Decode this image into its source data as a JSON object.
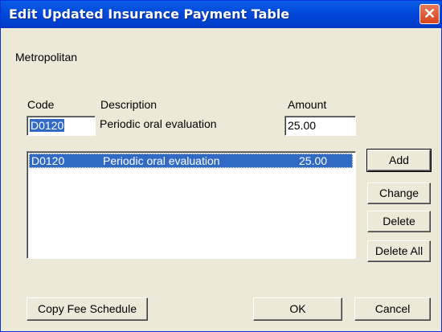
{
  "window": {
    "title": "Edit Updated Insurance Payment Table",
    "close_symbol": "✕"
  },
  "carrier": "Metropolitan",
  "form": {
    "code_label": "Code",
    "description_label": "Description",
    "amount_label": "Amount",
    "code_value": "D0120",
    "description_value": "Periodic oral evaluation",
    "amount_value": "25.00"
  },
  "list": {
    "rows": [
      {
        "code": "D0120",
        "description": "Periodic oral evaluation",
        "amount": "25.00",
        "selected": true
      }
    ]
  },
  "buttons": {
    "add": "Add",
    "change": "Change",
    "delete": "Delete",
    "delete_all": "Delete All",
    "copy_fee_schedule": "Copy Fee Schedule",
    "ok": "OK",
    "cancel": "Cancel"
  },
  "colors": {
    "title_bar": "#0145D6",
    "selection": "#316AC5",
    "dialog_bg": "#ECE9D8",
    "close_button": "#D7431D"
  },
  "icons": {
    "close": "close-icon"
  }
}
